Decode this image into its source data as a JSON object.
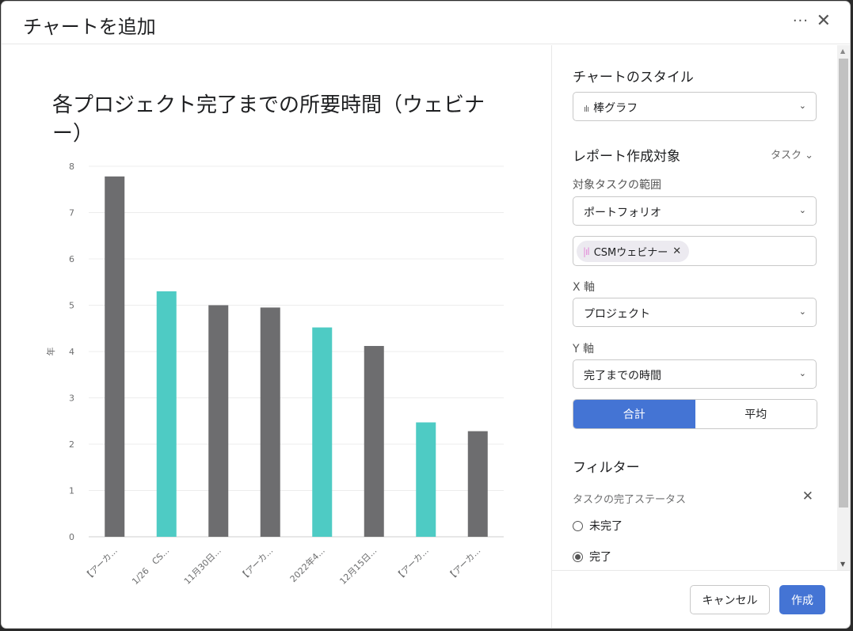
{
  "dialog": {
    "title": "チャートを追加",
    "more_icon": "ellipsis-icon",
    "close_icon": "close-icon"
  },
  "sidebar": {
    "chart_style_title": "チャートのスタイル",
    "chart_style_value": "棒グラフ",
    "chart_style_icon": "bar-chart-icon",
    "report_target_title": "レポート作成対象",
    "report_target_value": "タスク",
    "scope_label": "対象タスクの範囲",
    "scope_value": "ポートフォリオ",
    "chip_label": "CSMウェビナー",
    "x_axis_label": "X 軸",
    "x_axis_value": "プロジェクト",
    "y_axis_label": "Y 軸",
    "y_axis_value": "完了までの時間",
    "agg_total": "合計",
    "agg_average": "平均",
    "agg_selected": "合計",
    "filter_title": "フィルター",
    "filter_status_label": "タスクの完了ステータス",
    "radio_incomplete": "未完了",
    "radio_complete": "完了",
    "radio_selected": "完了"
  },
  "footer": {
    "cancel": "キャンセル",
    "create": "作成"
  },
  "colors": {
    "accent": "#4474d4",
    "bar_gray": "#6d6d6f",
    "bar_teal": "#4ecbc4",
    "chip_icon": "#e28ad9"
  },
  "chart_data": {
    "type": "bar",
    "title": "各プロジェクト完了までの所要時間（ウェビナー）",
    "ylabel": "年",
    "xlabel": "",
    "ylim": [
      0,
      8
    ],
    "yticks": [
      0,
      1,
      2,
      3,
      4,
      5,
      6,
      7,
      8
    ],
    "grid": true,
    "categories": [
      "【アーカ...",
      "1/26　CS...",
      "11月30日...",
      "【アーカ...",
      "2022年4...",
      "12月15日...",
      "【アーカ...",
      "【アーカ..."
    ],
    "values": [
      7.78,
      5.3,
      5.0,
      4.95,
      4.52,
      4.12,
      2.47,
      2.28
    ],
    "bar_colors": [
      "#6d6d6f",
      "#4ecbc4",
      "#6d6d6f",
      "#6d6d6f",
      "#4ecbc4",
      "#6d6d6f",
      "#4ecbc4",
      "#6d6d6f"
    ]
  }
}
